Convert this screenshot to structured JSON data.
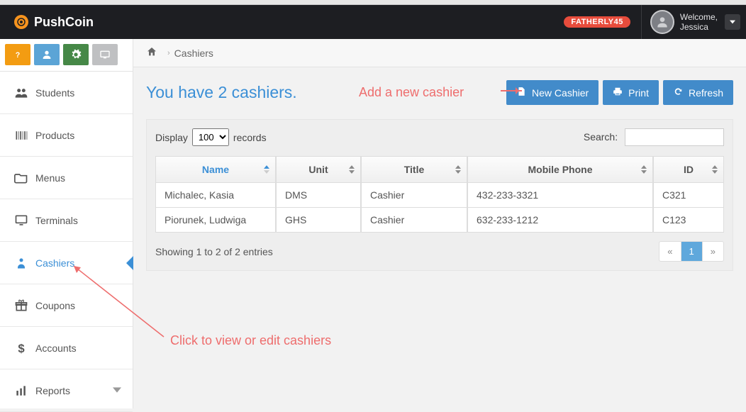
{
  "brand": "PushCoin",
  "account_badge": "FATHERLY45",
  "welcome_label": "Welcome,",
  "user_name": "Jessica",
  "breadcrumb": {
    "home": "Home",
    "current": "Cashiers"
  },
  "sidebar": {
    "items": [
      {
        "label": "Students"
      },
      {
        "label": "Products"
      },
      {
        "label": "Menus"
      },
      {
        "label": "Terminals"
      },
      {
        "label": "Cashiers"
      },
      {
        "label": "Coupons"
      },
      {
        "label": "Accounts"
      },
      {
        "label": "Reports"
      }
    ]
  },
  "headline": "You have 2 cashiers.",
  "annotations": {
    "add": "Add a new cashier",
    "click": "Click to view or edit cashiers"
  },
  "buttons": {
    "new_cashier": "New Cashier",
    "print": "Print",
    "refresh": "Refresh"
  },
  "table_toolbar": {
    "display_label": "Display",
    "records_label": "records",
    "page_size": "100",
    "search_label": "Search:"
  },
  "columns": {
    "name": "Name",
    "unit": "Unit",
    "title": "Title",
    "mobile": "Mobile Phone",
    "id": "ID"
  },
  "rows": [
    {
      "name": "Michalec, Kasia",
      "unit": "DMS",
      "title": "Cashier",
      "mobile": "432-233-3321",
      "id": "C321"
    },
    {
      "name": "Piorunek, Ludwiga",
      "unit": "GHS",
      "title": "Cashier",
      "mobile": "632-233-1212",
      "id": "C123"
    }
  ],
  "footer_info": "Showing 1 to 2 of 2 entries",
  "pager": {
    "prev": "«",
    "page": "1",
    "next": "»"
  }
}
